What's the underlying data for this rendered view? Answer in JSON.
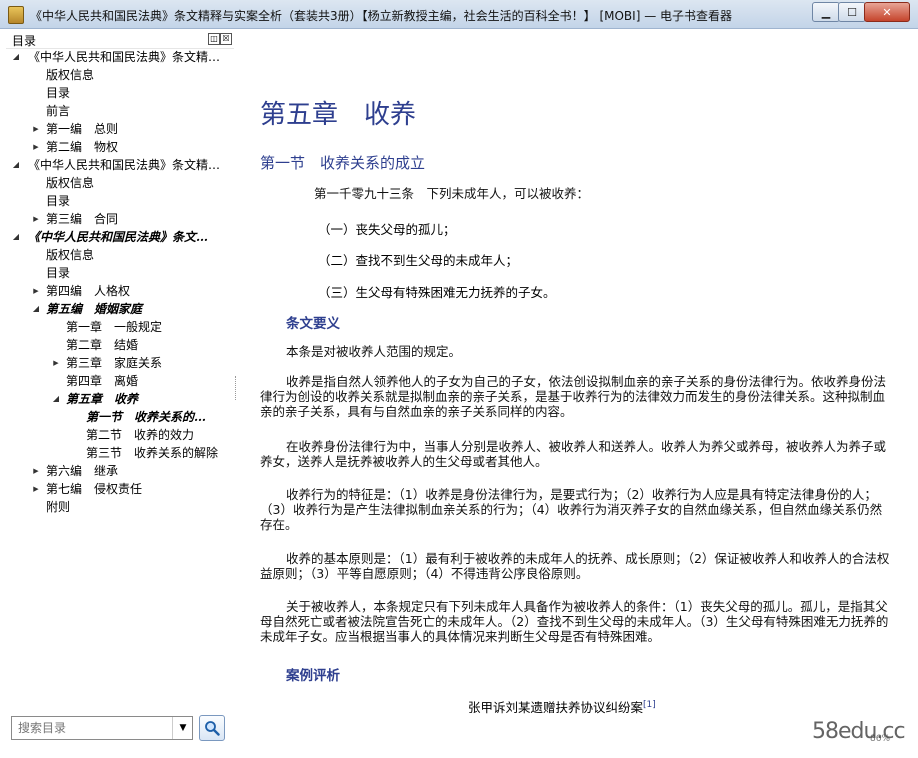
{
  "window": {
    "title": "《中华人民共和国民法典》条文精释与实案全析（套装共3册）【杨立新教授主编，社会生活的百科全书！】 [MOBI] — 电子书查看器",
    "buttons": {
      "minimize": "▁",
      "maximize": "☐",
      "close": "✕"
    }
  },
  "sidebar": {
    "title": "目录",
    "restore_icon": "◫",
    "close_icon": "☒",
    "tree": [
      {
        "label": "《中华人民共和国民法典》条文精…",
        "level": 0,
        "toggle": "expanded",
        "style": "normal"
      },
      {
        "label": "版权信息",
        "level": 1,
        "toggle": "none",
        "style": "normal"
      },
      {
        "label": "目录",
        "level": 1,
        "toggle": "none",
        "style": "normal"
      },
      {
        "label": "前言",
        "level": 1,
        "toggle": "none",
        "style": "normal"
      },
      {
        "label": "第一编　总则",
        "level": 1,
        "toggle": "collapsed",
        "style": "normal"
      },
      {
        "label": "第二编　物权",
        "level": 1,
        "toggle": "collapsed",
        "style": "normal"
      },
      {
        "label": "《中华人民共和国民法典》条文精…",
        "level": 0,
        "toggle": "expanded",
        "style": "normal"
      },
      {
        "label": "版权信息",
        "level": 1,
        "toggle": "none",
        "style": "normal"
      },
      {
        "label": "目录",
        "level": 1,
        "toggle": "none",
        "style": "normal"
      },
      {
        "label": "第三编　合同",
        "level": 1,
        "toggle": "collapsed",
        "style": "normal"
      },
      {
        "label": "《中华人民共和国民法典》条文…",
        "level": 0,
        "toggle": "expanded",
        "style": "italic"
      },
      {
        "label": "版权信息",
        "level": 1,
        "toggle": "none",
        "style": "normal"
      },
      {
        "label": "目录",
        "level": 1,
        "toggle": "none",
        "style": "normal"
      },
      {
        "label": "第四编　人格权",
        "level": 1,
        "toggle": "collapsed",
        "style": "normal"
      },
      {
        "label": "第五编　婚姻家庭",
        "level": 1,
        "toggle": "expanded",
        "style": "italic"
      },
      {
        "label": "第一章　一般规定",
        "level": 2,
        "toggle": "none",
        "style": "normal"
      },
      {
        "label": "第二章　结婚",
        "level": 2,
        "toggle": "none",
        "style": "normal"
      },
      {
        "label": "第三章　家庭关系",
        "level": 2,
        "toggle": "collapsed",
        "style": "normal"
      },
      {
        "label": "第四章　离婚",
        "level": 2,
        "toggle": "none",
        "style": "normal"
      },
      {
        "label": "第五章　收养",
        "level": 2,
        "toggle": "expanded",
        "style": "italic"
      },
      {
        "label": "第一节　收养关系的…",
        "level": 3,
        "toggle": "none",
        "style": "italic"
      },
      {
        "label": "第二节　收养的效力",
        "level": 3,
        "toggle": "none",
        "style": "normal"
      },
      {
        "label": "第三节　收养关系的解除",
        "level": 3,
        "toggle": "none",
        "style": "normal"
      },
      {
        "label": "第六编　继承",
        "level": 1,
        "toggle": "collapsed",
        "style": "normal"
      },
      {
        "label": "第七编　侵权责任",
        "level": 1,
        "toggle": "collapsed",
        "style": "normal"
      },
      {
        "label": "附则",
        "level": 1,
        "toggle": "none",
        "style": "normal"
      }
    ]
  },
  "search": {
    "placeholder": "搜索目录",
    "value": "搜索目录",
    "dropdown_icon": "chevron-down-icon",
    "button_icon": "magnifier-icon"
  },
  "content": {
    "chapter_title": "第五章　收养",
    "section_title": "第一节　收养关系的成立",
    "article": "第一千零九十三条　下列未成年人，可以被收养：",
    "items": [
      "（一）丧失父母的孤儿；",
      "（二）查找不到生父母的未成年人；",
      "（三）生父母有特殊困难无力抚养的子女。"
    ],
    "subhead_1": "条文要义",
    "paragraphs": [
      "本条是对被收养人范围的规定。",
      "收养是指自然人领养他人的子女为自己的子女，依法创设拟制血亲的亲子关系的身份法律行为。依收养身份法律行为创设的收养关系就是拟制血亲的亲子关系，是基于收养行为的法律效力而发生的身份法律关系。这种拟制血亲的亲子关系，具有与自然血亲的亲子关系同样的内容。",
      "在收养身份法律行为中，当事人分别是收养人、被收养人和送养人。收养人为养父或养母，被收养人为养子或养女，送养人是抚养被收养人的生父母或者其他人。",
      "收养行为的特征是：（1）收养是身份法律行为，是要式行为；（2）收养行为人应是具有特定法律身份的人；（3）收养行为是产生法律拟制血亲关系的行为；（4）收养行为消灭养子女的自然血缘关系，但自然血缘关系仍然存在。",
      "收养的基本原则是：（1）最有利于被收养的未成年人的抚养、成长原则；（2）保证被收养人和收养人的合法权益原则；（3）平等自愿原则；（4）不得违背公序良俗原则。",
      "关于被收养人，本条规定只有下列未成年人具备作为被收养人的条件：（1）丧失父母的孤儿。孤儿，是指其父母自然死亡或者被法院宣告死亡的未成年人。（2）查找不到生父母的未成年人。（3）生父母有特殊困难无力抚养的未成年子女。应当根据当事人的具体情况来判断生父母是否有特殊困难。"
    ],
    "subhead_2": "案例评析",
    "case_title": "张甲诉刘某遗赠扶养协议纠纷案",
    "case_note": "[1]",
    "zoom": "86%",
    "watermark": "58edu.cc"
  }
}
